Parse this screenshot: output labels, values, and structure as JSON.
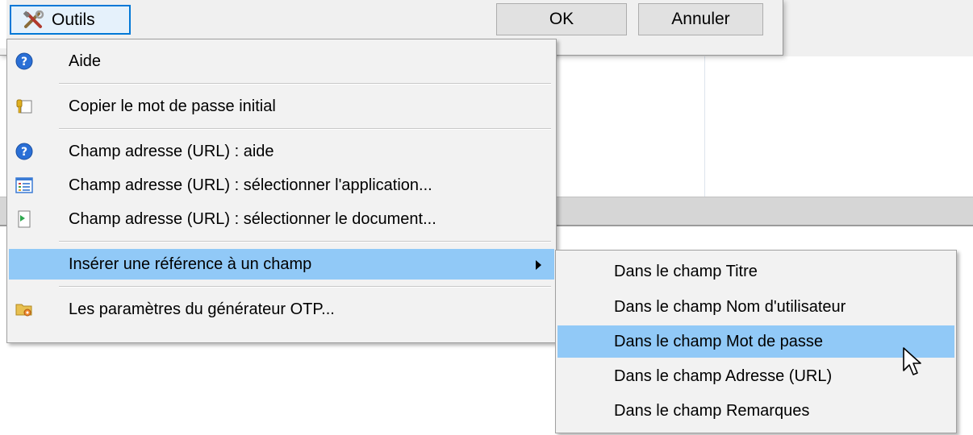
{
  "toolbar": {
    "tools_label": "Outils",
    "ok_label": "OK",
    "cancel_label": "Annuler"
  },
  "menu": {
    "items": [
      {
        "label": "Aide",
        "icon": "help-icon"
      },
      {
        "label": "Copier le mot de passe initial",
        "icon": "key-icon"
      },
      {
        "label": "Champ adresse (URL) : aide",
        "icon": "help-icon"
      },
      {
        "label": "Champ adresse (URL) : sélectionner l'application...",
        "icon": "application-list-icon"
      },
      {
        "label": "Champ adresse (URL) : sélectionner le document...",
        "icon": "document-icon"
      },
      {
        "label": "Insérer une référence à un champ",
        "icon": "none",
        "highlighted": true,
        "has_submenu": true
      },
      {
        "label": "Les paramètres du générateur OTP...",
        "icon": "folder-gear-icon"
      }
    ]
  },
  "submenu": {
    "items": [
      {
        "label": "Dans le champ Titre"
      },
      {
        "label": "Dans le champ Nom d'utilisateur"
      },
      {
        "label": "Dans le champ Mot de passe",
        "highlighted": true
      },
      {
        "label": "Dans le champ Adresse (URL)"
      },
      {
        "label": "Dans le champ Remarques"
      }
    ]
  },
  "colors": {
    "highlight": "#91c9f7",
    "focus_border": "#0078d7",
    "menu_background": "#f2f2f2"
  }
}
